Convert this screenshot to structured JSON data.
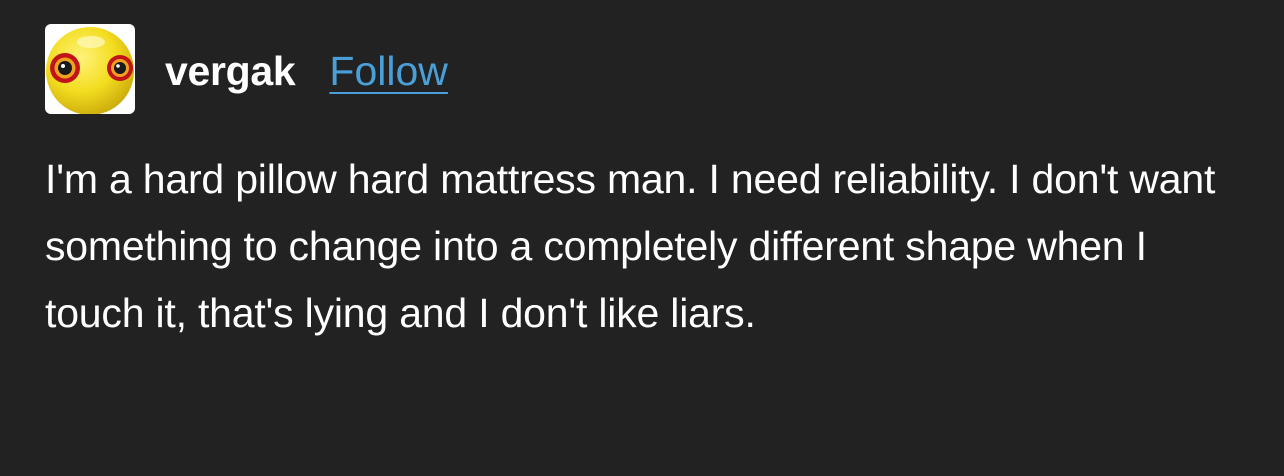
{
  "colors": {
    "background": "#222222",
    "text": "#ffffff",
    "follow_link": "#4a9fd8",
    "avatar_yellow": "#f3dd1f"
  },
  "post": {
    "author": {
      "avatar_icon": "yellow-eyeball-ball-avatar",
      "username": "vergak",
      "follow_label": "Follow"
    },
    "body": "I'm a hard pillow hard mattress man. I need reliability. I don't want something to change into a completely different shape when I touch it, that's lying and I don't like liars."
  }
}
